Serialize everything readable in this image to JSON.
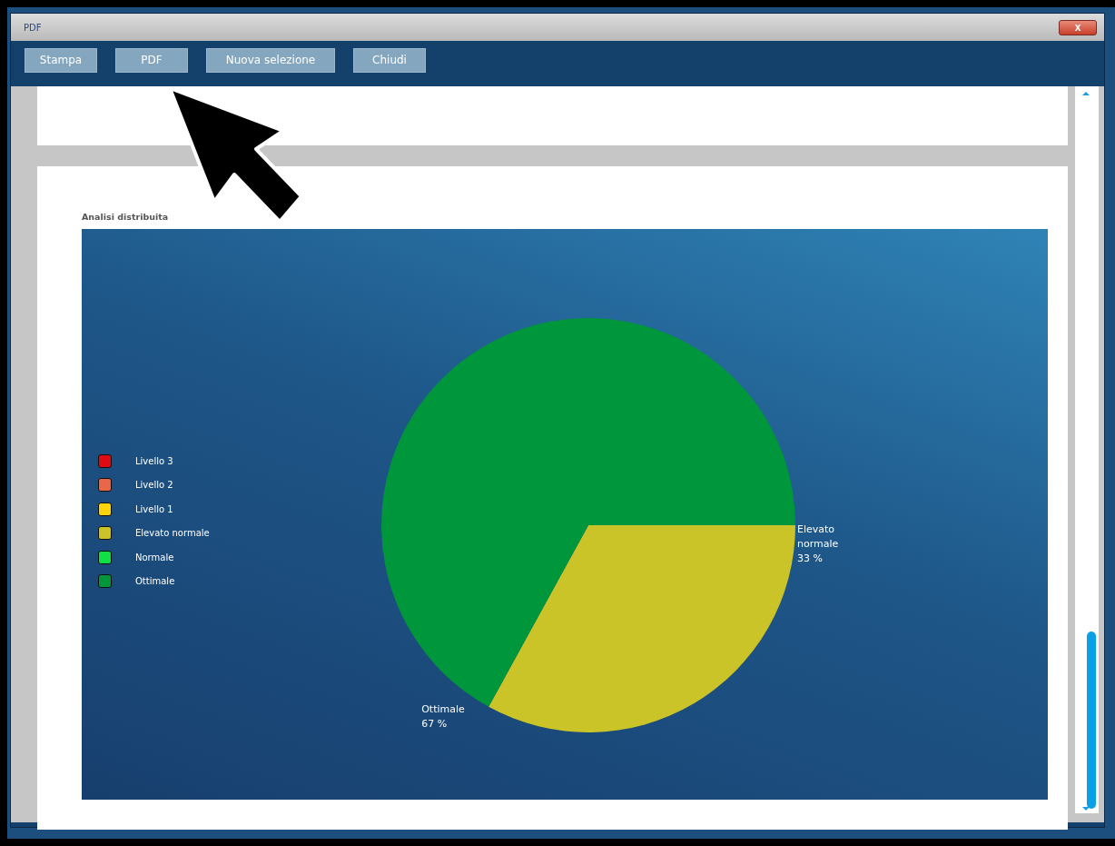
{
  "window": {
    "title": "PDF",
    "close_label": "x"
  },
  "toolbar": {
    "buttons": [
      "Stampa",
      "PDF",
      "Nuova selezione",
      "Chiudi"
    ]
  },
  "report": {
    "chart_data": {
      "type": "pie",
      "title": "Analisi distribuita",
      "categories": [
        "Elevato normale",
        "Ottimale"
      ],
      "values": [
        33,
        67
      ],
      "colors": [
        "#cbc428",
        "#00963c"
      ],
      "value_labels": [
        "33 %",
        "67 %"
      ]
    },
    "legend": [
      {
        "label": "Livello 3",
        "color": "#e00a14"
      },
      {
        "label": "Livello 2",
        "color": "#e8664a"
      },
      {
        "label": "Livello 1",
        "color": "#fcd40c"
      },
      {
        "label": "Elevato normale",
        "color": "#cbc428"
      },
      {
        "label": "Normale",
        "color": "#0ee048"
      },
      {
        "label": "Ottimale",
        "color": "#00963c"
      }
    ]
  }
}
